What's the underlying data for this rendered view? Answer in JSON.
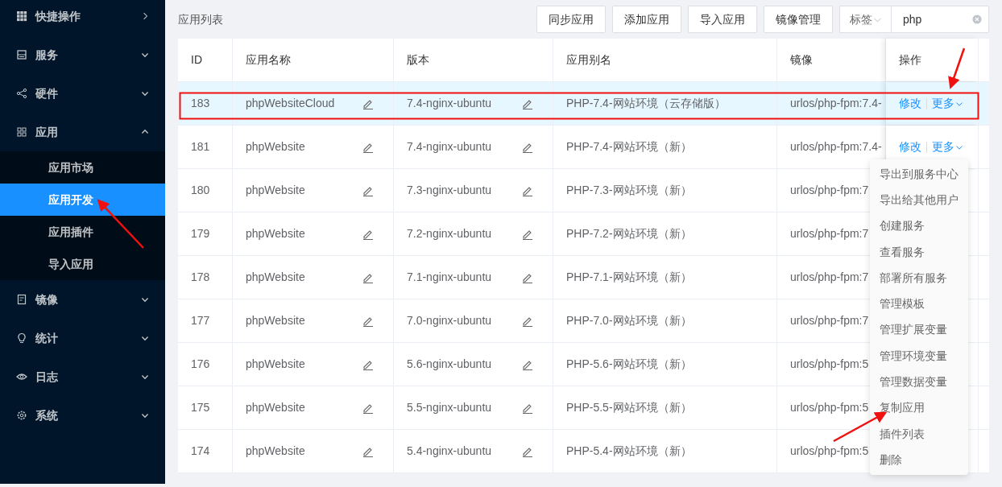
{
  "sidebar": {
    "items": [
      {
        "label": "快捷操作",
        "kind": "link"
      },
      {
        "label": "服务",
        "kind": "group",
        "expanded": false
      },
      {
        "label": "硬件",
        "kind": "group",
        "expanded": false
      },
      {
        "label": "应用",
        "kind": "group",
        "expanded": true,
        "children": [
          {
            "label": "应用市场",
            "selected": false
          },
          {
            "label": "应用开发",
            "selected": true
          },
          {
            "label": "应用插件",
            "selected": false
          },
          {
            "label": "导入应用",
            "selected": false
          }
        ]
      },
      {
        "label": "镜像",
        "kind": "group",
        "expanded": false
      },
      {
        "label": "统计",
        "kind": "group",
        "expanded": false
      },
      {
        "label": "日志",
        "kind": "group",
        "expanded": false
      },
      {
        "label": "系统",
        "kind": "group",
        "expanded": false
      }
    ]
  },
  "page_title": "应用列表",
  "toolbar": {
    "buttons": [
      "同步应用",
      "添加应用",
      "导入应用",
      "镜像管理"
    ],
    "tag_select": "标签",
    "search": {
      "value": "php"
    }
  },
  "table": {
    "columns": [
      "ID",
      "应用名称",
      "版本",
      "应用别名",
      "镜像",
      "操作"
    ],
    "rows": [
      {
        "id": "183",
        "name": "phpWebsiteCloud",
        "version": "7.4-nginx-ubuntu",
        "alias": "PHP-7.4-网站环境（云存储版）",
        "image": "urlos/php-fpm:7.4-",
        "selected": true,
        "actions": [
          "修改",
          "更多"
        ]
      },
      {
        "id": "181",
        "name": "phpWebsite",
        "version": "7.4-nginx-ubuntu",
        "alias": "PHP-7.4-网站环境（新）",
        "image": "urlos/php-fpm:7.4-",
        "selected": false,
        "actions": [
          "修改",
          "更多"
        ]
      },
      {
        "id": "180",
        "name": "phpWebsite",
        "version": "7.3-nginx-ubuntu",
        "alias": "PHP-7.3-网站环境（新）",
        "image": "urlos/php-fpm:7",
        "selected": false
      },
      {
        "id": "179",
        "name": "phpWebsite",
        "version": "7.2-nginx-ubuntu",
        "alias": "PHP-7.2-网站环境（新）",
        "image": "urlos/php-fpm:7",
        "selected": false
      },
      {
        "id": "178",
        "name": "phpWebsite",
        "version": "7.1-nginx-ubuntu",
        "alias": "PHP-7.1-网站环境（新）",
        "image": "urlos/php-fpm:7",
        "selected": false
      },
      {
        "id": "177",
        "name": "phpWebsite",
        "version": "7.0-nginx-ubuntu",
        "alias": "PHP-7.0-网站环境（新）",
        "image": "urlos/php-fpm:7",
        "selected": false
      },
      {
        "id": "176",
        "name": "phpWebsite",
        "version": "5.6-nginx-ubuntu",
        "alias": "PHP-5.6-网站环境（新）",
        "image": "urlos/php-fpm:5",
        "selected": false
      },
      {
        "id": "175",
        "name": "phpWebsite",
        "version": "5.5-nginx-ubuntu",
        "alias": "PHP-5.5-网站环境（新）",
        "image": "urlos/php-fpm:5",
        "selected": false
      },
      {
        "id": "174",
        "name": "phpWebsite",
        "version": "5.4-nginx-ubuntu",
        "alias": "PHP-5.4-网站环境（新）",
        "image": "urlos/php-fpm:5",
        "selected": false
      }
    ]
  },
  "more_menu": {
    "items": [
      "导出到服务中心",
      "导出给其他用户",
      "创建服务",
      "查看服务",
      "部署所有服务",
      "管理模板",
      "管理扩展变量",
      "管理环境变量",
      "管理数据变量",
      "复制应用",
      "插件列表",
      "删除"
    ]
  }
}
